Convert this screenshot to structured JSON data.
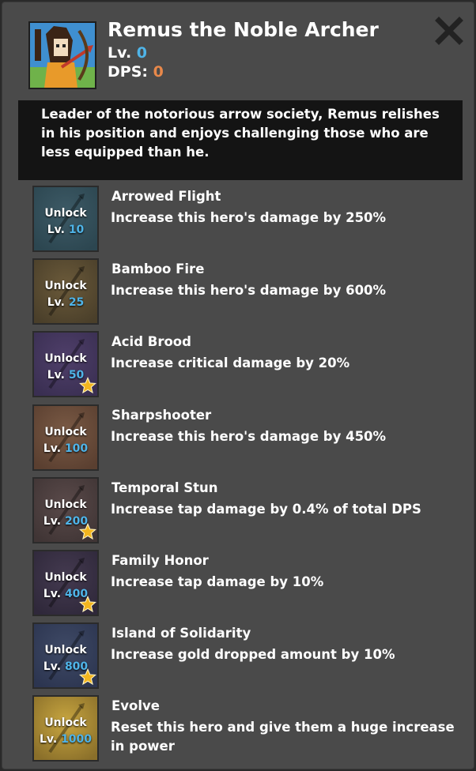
{
  "hero": {
    "name": "Remus the Noble Archer",
    "level_label": "Lv.",
    "level": "0",
    "dps_label": "DPS:",
    "dps": "0",
    "description": "Leader of the notorious arrow society, Remus relishes in his position and enjoys challenging those who are less equipped than he."
  },
  "colors": {
    "panel": "#4a4a4a",
    "desc_bg": "#141414",
    "level_value": "#4fb4e8",
    "dps_value": "#e8884a",
    "star": "#f3b61f"
  },
  "close_icon": "close-icon",
  "skills": [
    {
      "name": "Arrowed Flight",
      "desc": "Increase this hero's damage by 250%",
      "unlock": "Unlock",
      "lv_label": "Lv.",
      "lv": "10",
      "star": false
    },
    {
      "name": "Bamboo Fire",
      "desc": "Increase this hero's damage by 600%",
      "unlock": "Unlock",
      "lv_label": "Lv.",
      "lv": "25",
      "star": false
    },
    {
      "name": "Acid Brood",
      "desc": "Increase critical damage by 20%",
      "unlock": "Unlock",
      "lv_label": "Lv.",
      "lv": "50",
      "star": true
    },
    {
      "name": "Sharpshooter",
      "desc": "Increase this hero's damage by 450%",
      "unlock": "Unlock",
      "lv_label": "Lv.",
      "lv": "100",
      "star": false
    },
    {
      "name": "Temporal Stun",
      "desc": "Increase tap damage by 0.4% of total DPS",
      "unlock": "Unlock",
      "lv_label": "Lv.",
      "lv": "200",
      "star": true
    },
    {
      "name": "Family Honor",
      "desc": "Increase tap damage by 10%",
      "unlock": "Unlock",
      "lv_label": "Lv.",
      "lv": "400",
      "star": true
    },
    {
      "name": "Island of Solidarity",
      "desc": "Increase gold dropped amount by 10%",
      "unlock": "Unlock",
      "lv_label": "Lv.",
      "lv": "800",
      "star": true
    },
    {
      "name": "Evolve",
      "desc": "Reset this hero and give them a huge increase in power",
      "unlock": "Unlock",
      "lv_label": "Lv.",
      "lv": "1000",
      "star": false
    }
  ]
}
